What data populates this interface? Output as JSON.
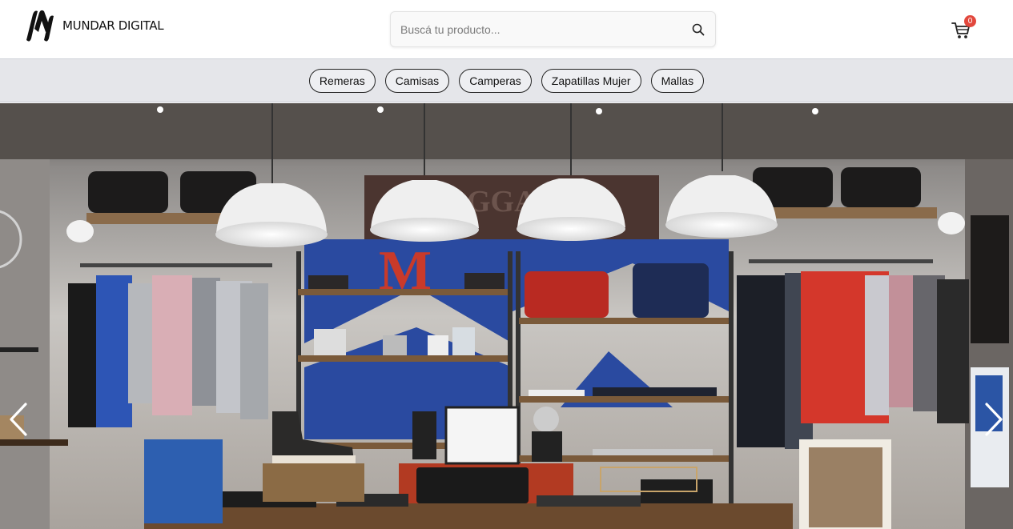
{
  "header": {
    "logo_text": "MUNDAR DIGITAL",
    "search_placeholder": "Buscá tu producto...",
    "cart_count": "0"
  },
  "categories": [
    "Remeras",
    "Camisas",
    "Camperas",
    "Zapatillas Mujer",
    "Mallas"
  ],
  "carousel": {
    "prev_icon": "chevron-left-icon",
    "next_icon": "chevron-right-icon"
  },
  "colors": {
    "badge": "#e2483d",
    "category_bar": "#e5e6ea"
  }
}
